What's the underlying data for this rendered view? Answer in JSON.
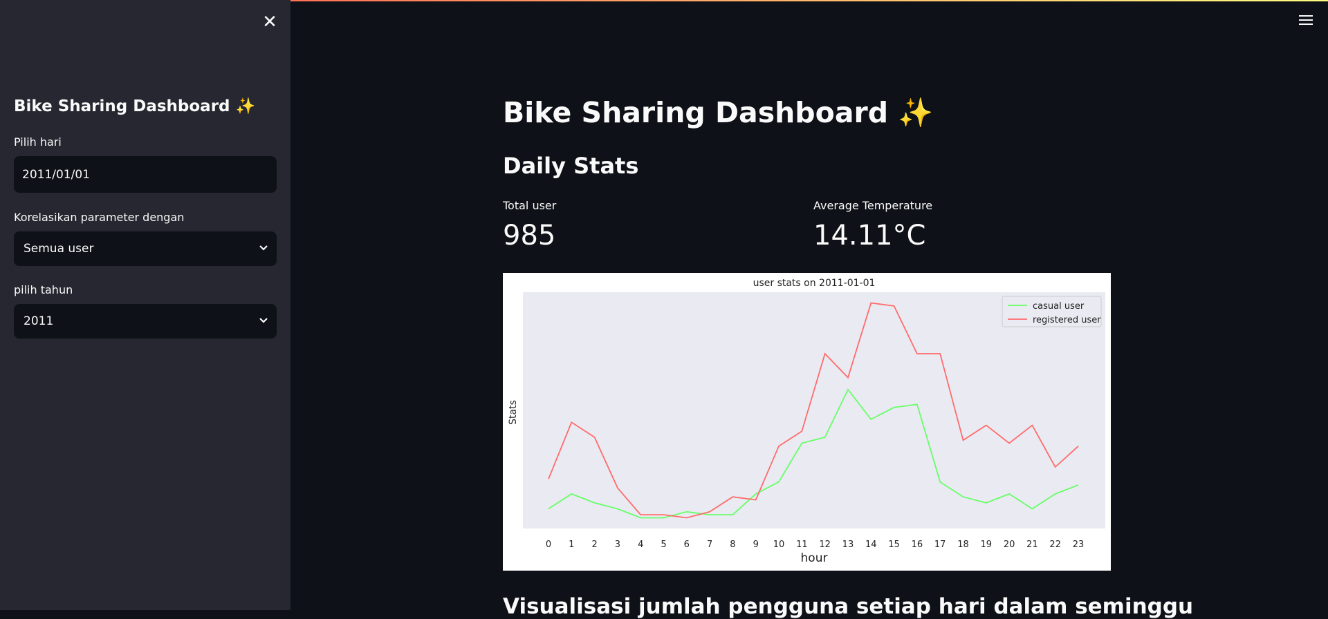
{
  "sidebar": {
    "title": "Bike Sharing Dashboard ✨",
    "date_label": "Pilih hari",
    "date_value": "2011/01/01",
    "correlate_label": "Korelasikan parameter dengan",
    "correlate_value": "Semua user",
    "year_label": "pilih tahun",
    "year_value": "2011"
  },
  "main": {
    "title": "Bike Sharing Dashboard ✨",
    "daily_heading": "Daily Stats",
    "metrics": [
      {
        "label": "Total user",
        "value": "985"
      },
      {
        "label": "Average Temperature",
        "value": "14.11°C"
      }
    ],
    "weekly_heading": "Visualisasi jumlah pengguna setiap hari dalam seminggu"
  },
  "colors": {
    "accent_casual": "#66ff66",
    "accent_registered": "#ff6b6b"
  },
  "chart_data": {
    "type": "line",
    "title": "user stats on 2011-01-01",
    "xlabel": "hour",
    "ylabel": "Stats",
    "categories": [
      "0",
      "1",
      "2",
      "3",
      "4",
      "5",
      "6",
      "7",
      "8",
      "9",
      "10",
      "11",
      "12",
      "13",
      "14",
      "15",
      "16",
      "17",
      "18",
      "19",
      "20",
      "21",
      "22",
      "23"
    ],
    "legend_position": "top-right",
    "grid": false,
    "series": [
      {
        "name": "casual user",
        "color": "#66ff66",
        "values": [
          3,
          8,
          5,
          3,
          0,
          0,
          2,
          1,
          1,
          8,
          12,
          25,
          27,
          43,
          33,
          37,
          38,
          12,
          7,
          5,
          8,
          3,
          8,
          11
        ]
      },
      {
        "name": "registered user",
        "color": "#ff6b6b",
        "values": [
          13,
          32,
          27,
          10,
          1,
          1,
          0,
          2,
          7,
          6,
          24,
          29,
          55,
          47,
          72,
          71,
          55,
          55,
          26,
          31,
          25,
          31,
          17,
          24
        ]
      }
    ]
  }
}
